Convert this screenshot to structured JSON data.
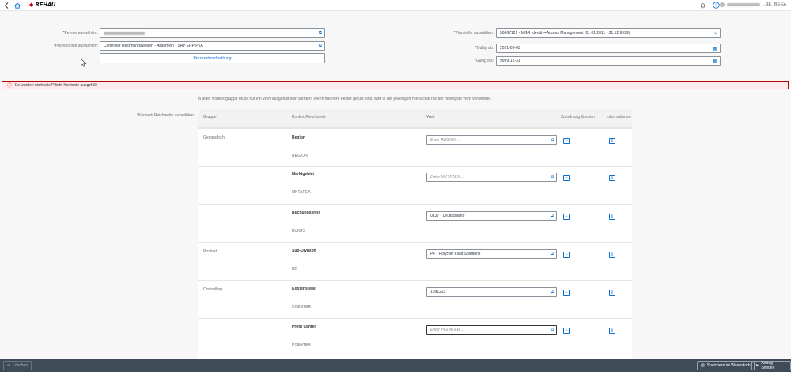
{
  "shell": {
    "back_icon": "back-arrow-icon",
    "home_icon": "home-icon",
    "logo_text": "REHAU",
    "notification_icon": "notification-icon",
    "help_icon": "help-icon",
    "user_suffix": "...RE, IBS-EA"
  },
  "form": {
    "person_label": "Person auswählen:",
    "prozessrolle_label": "Prozessrolle auswählen:",
    "prozessrolle_value": "Controller Rechnungswesen - Allgemein - SAP ERP P1A",
    "prozessbeschreibung_button": "Prozessbeschreibung",
    "planstelle_label": "Planstelle auswählen:",
    "planstelle_value": "50067121 - MGR Identity+Access Management (01.01.2011 - 31.12.9999)",
    "gueltig_ab_label": "Gültig ab:",
    "gueltig_ab_value": "2021-03-05",
    "gueltig_bis_label": "Gültig bis:",
    "gueltig_bis_value": "9999-12-31"
  },
  "message": {
    "error_text": "Es wurden nicht alle Pflicht-Kontexte ausgefüllt"
  },
  "context": {
    "hint": "In jeder Kontextgruppe muss nur ein Wert ausgefüllt sein werden. Wenn mehrere Felder gefüllt sind, wird in der jeweiligen Hierarchie nur der niedrigste Wert verwendet.",
    "label": "Kontext/ Reichweite auswählen:",
    "headers": {
      "gruppe": "Gruppe",
      "kontext": "Kontext/Reichweite",
      "wert": "Wert",
      "zuordnung": "Zuordnung löschen",
      "informationen": "Informationen"
    },
    "rows": [
      {
        "gruppe": "Geografisch",
        "name": "Region",
        "code": "REGION",
        "value": "",
        "placeholder": "Enter REGION ..."
      },
      {
        "gruppe": "",
        "name": "Marktgebiet",
        "code": "MKTAREA",
        "value": "",
        "placeholder": "Enter MKTAREA ..."
      },
      {
        "gruppe": "",
        "name": "Buchungskreis",
        "code": "BUKRS",
        "value": "0137 - Deutschland",
        "placeholder": ""
      },
      {
        "gruppe": "Produkt",
        "name": "Sub-Division",
        "code": "BD",
        "value": "PF - Polymer Fluid Solutions",
        "placeholder": ""
      },
      {
        "gruppe": "Controlling",
        "name": "Kostenstelle",
        "code": "CCENTER",
        "value": "1091223",
        "placeholder": ""
      },
      {
        "gruppe": "",
        "name": "Profit Center",
        "code": "PCENTER",
        "value": "",
        "placeholder": "Enter PCENTER ..."
      }
    ]
  },
  "footer": {
    "loeschen": "Löschen",
    "speichern": "Speichern im Warenkorb",
    "senden": "Antrag Senden"
  },
  "colors": {
    "accent": "#0a6ed1",
    "error": "#bb0000",
    "footer_bg": "#3f4b57"
  }
}
